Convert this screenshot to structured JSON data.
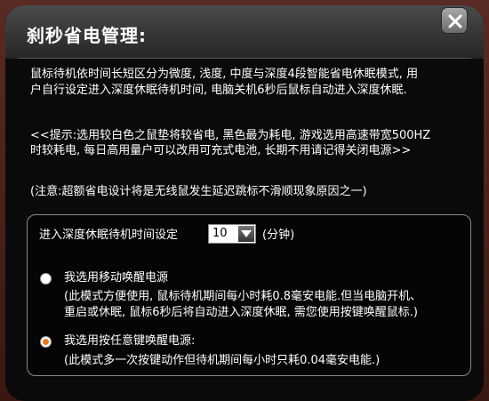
{
  "window": {
    "title": "刹秒省电管理:"
  },
  "description": {
    "line1": "鼠标待机依时间长短区分为微度, 浅度, 中度与深度4段智能省电休眠模式, 用",
    "line2": "户自行设定进入深度休眠待机时间, 电脑关机6秒后鼠标自动进入深度休眠."
  },
  "tip": {
    "line1": "<<提示:选用较白色之鼠垫将较省电, 黑色最为耗电, 游戏选用高速带宽500HZ",
    "line2": "时较耗电, 每日高用量户可以改用可充式电池, 长期不用请记得关闭电源>>"
  },
  "note": "(注意:超额省电设计将是无线鼠发生延迟跳标不滑顺现象原因之一)",
  "sleep_setting": {
    "label": "进入深度休眠待机时间设定",
    "value": "10",
    "unit": "(分钟)"
  },
  "options": [
    {
      "label": "我选用移动唤醒电源",
      "desc_line1": "(此模式方便使用, 鼠标待机期间每小时耗0.8毫安电能.但当电脑开机、",
      "desc_line2": "重启或休眠, 鼠标6秒后将自动进入深度休眠, 需您使用按键唤醒鼠标.)",
      "selected": false
    },
    {
      "label": "我选用按任意键唤醒电源:",
      "desc_line1": "(此模式多一次按键动作但待机期间每小时只耗0.04毫安电能.)",
      "selected": true
    }
  ],
  "colors": {
    "radio_selected": "#e07a2a",
    "text": "#ffffff",
    "background": "#0a0a0a"
  },
  "icons": {
    "close": "close-icon",
    "dropdown": "chevron-down-icon"
  }
}
